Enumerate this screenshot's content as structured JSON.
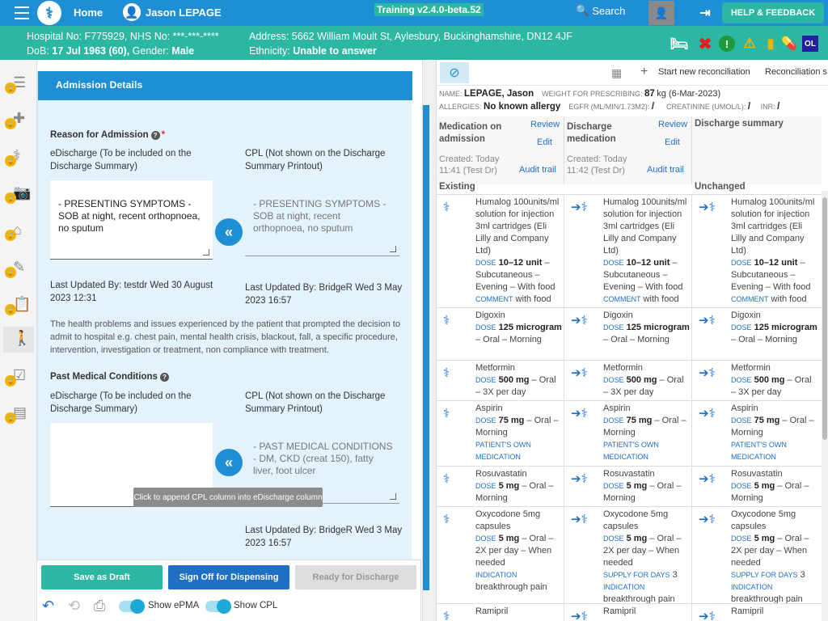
{
  "app": {
    "home": "Home",
    "user": "Jason LEPAGE",
    "version": "Training v2.4.0-beta.52",
    "search": "Search",
    "help": "HELP & FEEDBACK"
  },
  "patient": {
    "line1a": "Hospital No: F775929, NHS No: ***-***-****",
    "line2a_label": "DoB:",
    "line2a_dob": "17 Jul 1963 (60),",
    "line2a_gender_label": "Gender:",
    "line2a_gender": "Male",
    "line1b": "Address: 5662 William Moult St, Aylesbury, Buckinghamshire, DN12 4JF",
    "line2b_label": "Ethnicity:",
    "line2b": "Unable to answer",
    "ol": "OL"
  },
  "admission": {
    "title": "Admission Details",
    "reason_title": "Reason for Admission",
    "ed_label": "eDischarge (To be included on the Discharge Summary)",
    "cpl_label": "CPL (Not shown on the Discharge Summary Printout)",
    "reason_ed": "- PRESENTING SYMPTOMS - SOB at night, recent orthopnoea, no sputum",
    "reason_cpl": "- PRESENTING SYMPTOMS - SOB at night, recent orthopnoea, no sputum",
    "ed_updated": "Last Updated By: testdr Wed 30 August 2023 12:31",
    "cpl_updated": "Last Updated By: BridgeR Wed 3 May 2023 16:57",
    "reason_help": "The health problems and issues experienced by the patient that prompted the decision to admit to hospital e.g. chest pain, mental health crisis, blackout, fall,  a specific procedure, intervention, investigation or treatment, non compliance with treatment.",
    "pmc_title": "Past Medical Conditions",
    "pmc_ed": "",
    "pmc_cpl": "- PAST MEDICAL CONDITIONS - DM, CKD (creat 150), fatty liver, foot ulcer",
    "pmc_cpl_updated": "Last Updated By: BridgeR Wed 3 May 2023 16:57",
    "tooltip": "Click to append CPL column into eDischarge column"
  },
  "actions": {
    "draft": "Save as Draft",
    "sign": "Sign Off for Dispensing",
    "ready": "Ready for Discharge",
    "show_epma": "Show ePMA",
    "show_cpl": "Show CPL"
  },
  "recon": {
    "start": "Start new reconciliation",
    "tab2": "Reconciliation s",
    "name_k": "NAME:",
    "name_v": "LEPAGE, Jason",
    "weight_k": "WEIGHT FOR PRESCRIBING:",
    "weight_v": "87",
    "weight_u": "kg (6-Mar-2023)",
    "allergy_k": "ALLERGIES:",
    "allergy_v": "No known allergy",
    "egfr_k": "EGFR (ML/MIN/1.73M2):",
    "egfr_v": "/",
    "creat_k": "CREATININE (UMOL/L):",
    "creat_v": "/",
    "inr_k": "INR:",
    "inr_v": "/",
    "col1": "Medication on admission",
    "col2": "Discharge medication",
    "col3": "Discharge summary",
    "review": "Review",
    "edit": "Edit",
    "audit": "Audit trail",
    "c1_created": "Created: Today",
    "c1_time": "11:41 (Test Dr)",
    "c2_created": "Created: Today",
    "c2_time": "11:42 (Test Dr)",
    "grp1": "Existing",
    "grp3": "Unchanged"
  },
  "meds": [
    {
      "name": "Humalog 100units/ml solution for injection 3ml cartridges (Eli Lilly and Company Ltd)",
      "dose_k": "DOSE",
      "dose": "10–12 unit",
      "rest": " – Subcutaneous – Evening – With food",
      "x_k": "COMMENT",
      "x": " with food"
    },
    {
      "name": "Digoxin",
      "dose_k": "DOSE",
      "dose": "125 microgram",
      "rest": " – Oral – Morning",
      "x_k": "",
      "x": ""
    },
    {
      "name": "Metformin",
      "dose_k": "DOSE",
      "dose": "500 mg",
      "rest": " – Oral – 3X per day",
      "x_k": "",
      "x": ""
    },
    {
      "name": "Aspirin",
      "dose_k": "DOSE",
      "dose": "75 mg",
      "rest": " – Oral – Morning",
      "x_k": "PATIENT'S OWN MEDICATION",
      "x": ""
    },
    {
      "name": "Rosuvastatin",
      "dose_k": "DOSE",
      "dose": "5 mg",
      "rest": " – Oral – Morning",
      "x_k": "",
      "x": ""
    },
    {
      "name": "Oxycodone 5mg capsules",
      "dose_k": "DOSE",
      "dose": "5 mg",
      "rest": " – Oral – 2X per day – When needed",
      "x_k": "INDICATION",
      "x": " breakthrough pain"
    },
    {
      "name": "Ramipril",
      "dose_k": "",
      "dose": "",
      "rest": "",
      "x_k": "",
      "x": ""
    }
  ],
  "meds_col2_supply": {
    "k": "SUPPLY FOR DAYS",
    "v": "3"
  }
}
